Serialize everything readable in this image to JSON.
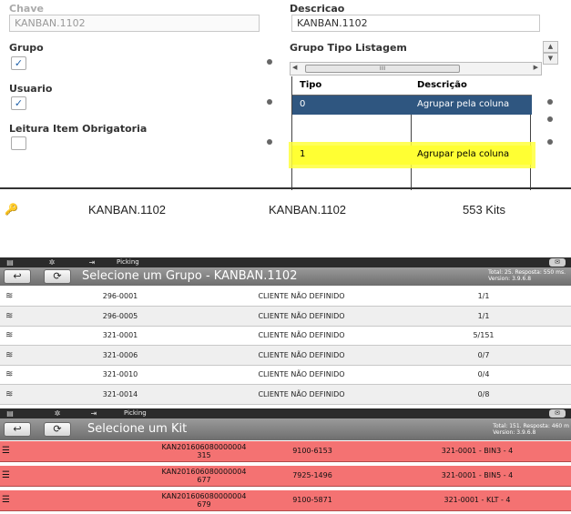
{
  "form": {
    "chave_label": "Chave",
    "chave_value": "KANBAN.1102",
    "descricao_label": "Descricao",
    "descricao_value": "KANBAN.1102",
    "grupo_label": "Grupo",
    "grupo_checked": "✓",
    "usuario_label": "Usuario",
    "usuario_checked": "✓",
    "leitura_label": "Leitura Item Obrigatoria",
    "grupo_tipo_label": "Grupo Tipo Listagem",
    "scroll_up": "▲",
    "scroll_down": "▼",
    "scroll_left": "◀",
    "scroll_right": "▶",
    "scroll_grip": "IIII",
    "grid": {
      "headers": [
        "Tipo",
        "Descrição"
      ],
      "rows": [
        [
          "0",
          "Agrupar pela coluna"
        ],
        [
          "1",
          "Agrupar pela coluna"
        ]
      ]
    }
  },
  "summary": {
    "key_icon": "🔑",
    "col1": "KANBAN.1102",
    "col2": "KANBAN.1102",
    "col3": "553 Kits"
  },
  "topbar": {
    "menu_icon": "▤",
    "gear_icon": "✲",
    "exit_icon": "⇥",
    "title": "Picking",
    "mail_icon": "✉"
  },
  "group_screen": {
    "back_icon": "↩",
    "refresh_icon": "⟳",
    "title": "Selecione um Grupo - KANBAN.1102",
    "info_line1": "Total: 25. Resposta: 550 ms.",
    "info_line2": "Version: 3.9.6.8",
    "row_icon": "≋",
    "rows": [
      {
        "code": "296-0001",
        "client": "CLIENTE NÃO DEFINIDO",
        "qty": "1/1"
      },
      {
        "code": "296-0005",
        "client": "CLIENTE NÃO DEFINIDO",
        "qty": "1/1"
      },
      {
        "code": "321-0001",
        "client": "CLIENTE NÃO DEFINIDO",
        "qty": "5/151"
      },
      {
        "code": "321-0006",
        "client": "CLIENTE NÃO DEFINIDO",
        "qty": "0/7"
      },
      {
        "code": "321-0010",
        "client": "CLIENTE NÃO DEFINIDO",
        "qty": "0/4"
      },
      {
        "code": "321-0014",
        "client": "CLIENTE NÃO DEFINIDO",
        "qty": "0/8"
      }
    ]
  },
  "kit_screen": {
    "back_icon": "↩",
    "refresh_icon": "⟳",
    "title": "Selecione um Kit",
    "info_line1": "Total: 151. Resposta: 460 m",
    "info_line2": "Version: 3.9.6.8",
    "row_icon": "☰",
    "row_color": "#f47272",
    "rows": [
      {
        "code_a": "KAN201606080000004",
        "code_b": "315",
        "part": "9100-6153",
        "loc": "321-0001 - BIN3 - 4"
      },
      {
        "code_a": "KAN201606080000004",
        "code_b": "677",
        "part": "7925-1496",
        "loc": "321-0001 - BIN5 - 4"
      },
      {
        "code_a": "KAN201606080000004",
        "code_b": "679",
        "part": "9100-5871",
        "loc": "321-0001 - KLT - 4"
      }
    ]
  }
}
